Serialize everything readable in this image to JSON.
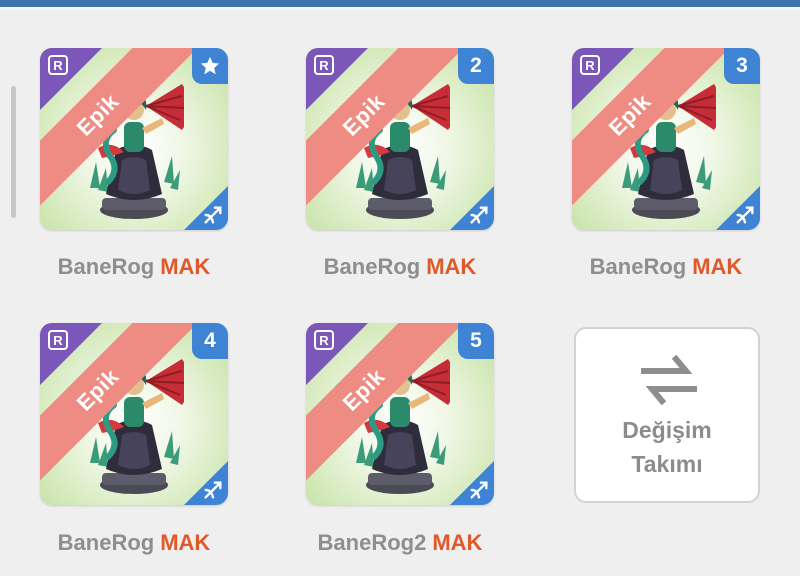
{
  "colors": {
    "accent": "#e0592b",
    "rarity_ribbon": "#ee8b83",
    "badge_blue": "#3f83d4",
    "corner_purple": "#7a57b8",
    "top_bar": "#3d74ad"
  },
  "cards": [
    {
      "rarity": "Epik",
      "badge": "",
      "badge_icon": "star-icon",
      "name": "BaneRog",
      "tag": "MAK"
    },
    {
      "rarity": "Epik",
      "badge": "2",
      "name": "BaneRog",
      "tag": "MAK"
    },
    {
      "rarity": "Epik",
      "badge": "3",
      "name": "BaneRog",
      "tag": "MAK"
    },
    {
      "rarity": "Epik",
      "badge": "4",
      "name": "BaneRog",
      "tag": "MAK"
    },
    {
      "rarity": "Epik",
      "badge": "5",
      "name": "BaneRog2",
      "tag": "MAK"
    }
  ],
  "team_swap": {
    "line1": "Değişim",
    "line2": "Takımı",
    "icon": "swap-arrows-icon"
  }
}
